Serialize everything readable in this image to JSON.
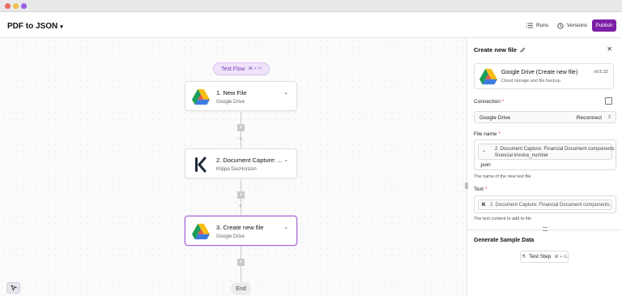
{
  "window": {
    "controls": [
      "close",
      "minimize",
      "maximize"
    ]
  },
  "header": {
    "flow_title": "PDF to JSON",
    "runs_label": "Runs",
    "versions_label": "Versions",
    "publish_label": "Publish",
    "accent_color": "#7c1fa6"
  },
  "canvas": {
    "test_flow_label": "Test Flow",
    "test_flow_shortcut": "⌘ + ⏎",
    "nodes": [
      {
        "title": "1. New File",
        "subtitle": "Google Drive",
        "icon": "google-drive-icon"
      },
      {
        "title": "2. Document Capture: ...",
        "subtitle": "Klippa DocHorizon",
        "icon": "klippa-icon"
      },
      {
        "title": "3. Create new file",
        "subtitle": "Google Drive",
        "icon": "google-drive-icon",
        "selected": true
      }
    ],
    "end_label": "End"
  },
  "panel": {
    "title": "Create new file",
    "app_name": "Google Drive (Create new file)",
    "app_description": "Cloud storage and file backup",
    "app_version": "v0.5.32",
    "connection_label": "Connection",
    "connection_value": "Google Drive",
    "reconnect_label": "Reconnect",
    "file_name_label": "File name",
    "file_name_chip_line1": "2. Document Capture: Financial Document components",
    "file_name_chip_line2": "financial invoice_number",
    "file_name_suffix": ".json",
    "file_name_hint": "The name of the new text file",
    "text_label": "Text",
    "text_chip": "2. Document Capture: Financial Document components",
    "text_hint": "The text content to add to file",
    "generate_title": "Generate Sample Data",
    "test_step_label": "Test Step",
    "test_step_shortcut": "⌘ + G"
  }
}
